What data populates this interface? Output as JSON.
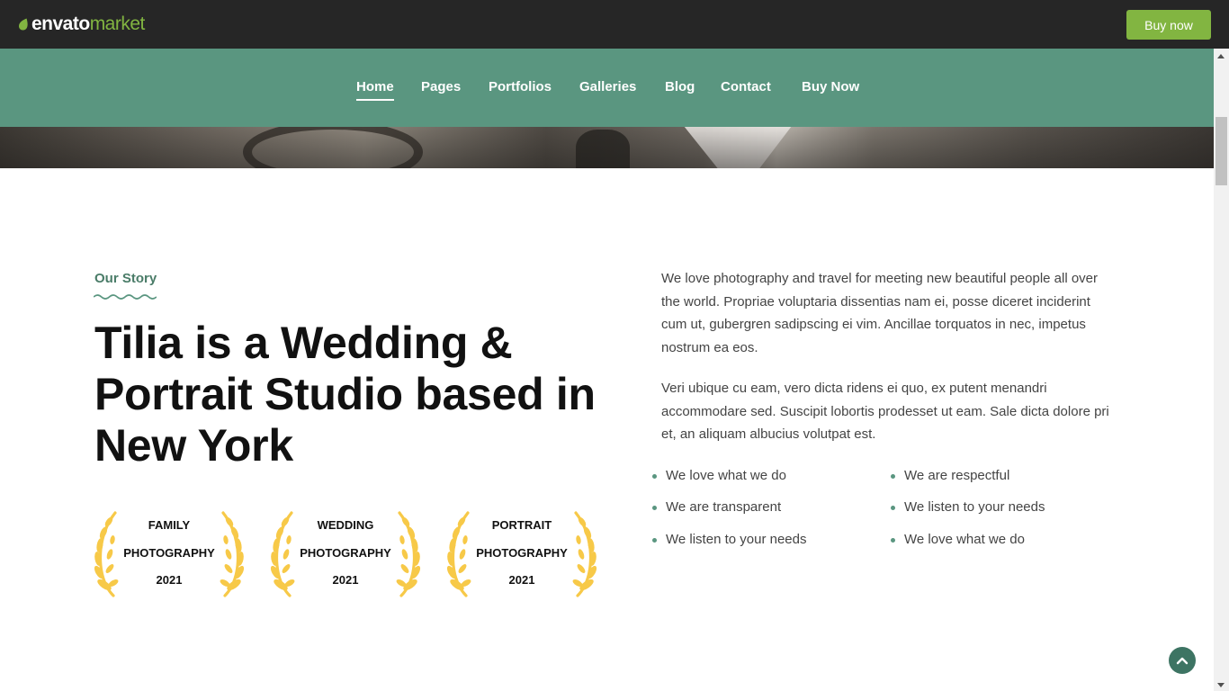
{
  "topbar": {
    "logo_word1": "envato",
    "logo_word2": "market",
    "buy_label": "Buy now"
  },
  "nav": {
    "items": [
      {
        "label": "Home"
      },
      {
        "label": "Pages"
      },
      {
        "label": "Portfolios"
      },
      {
        "label": "Galleries"
      },
      {
        "label": "Blog"
      },
      {
        "label": "Contact"
      },
      {
        "label": "Buy Now"
      }
    ]
  },
  "story": {
    "eyebrow": "Our Story",
    "title": "Tilia is a Wedding & Portrait Studio based in New York",
    "paragraph1": "We love photography and travel for meeting new beautiful people all over the world. Propriae voluptaria dissentias nam ei, posse diceret inciderint cum ut, gubergren sadipscing ei vim. Ancillae torquatos in nec, impetus nostrum ea eos.",
    "paragraph2": "Veri ubique cu eam, vero dicta ridens ei quo, ex putent menandri accommodare sed. Suscipit lobortis prodesset ut eam. Sale dicta dolore pri et, an aliquam albucius volutpat est.",
    "bullets_left": [
      "We love what we do",
      "We are transparent",
      "We listen to your needs"
    ],
    "bullets_right": [
      "We are respectful",
      "We listen to your needs",
      "We love what we do"
    ]
  },
  "awards": [
    {
      "line1": "FAMILY",
      "line2": "PHOTOGRAPHY",
      "line3": "2021"
    },
    {
      "line1": "WEDDING",
      "line2": "PHOTOGRAPHY",
      "line3": "2021"
    },
    {
      "line1": "PORTRAIT",
      "line2": "PHOTOGRAPHY",
      "line3": "2021"
    }
  ],
  "colors": {
    "topbar_bg": "#262626",
    "brand_green": "#82b541",
    "nav_bg": "#5a9680",
    "accent": "#4a7c68",
    "laurel": "#f7c948"
  },
  "icons": {
    "logo": "envato-leaf-icon",
    "back_to_top": "chevron-up-icon"
  }
}
